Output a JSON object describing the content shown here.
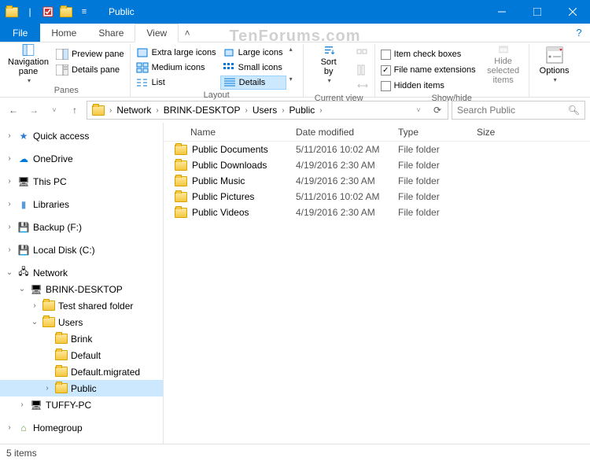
{
  "window": {
    "title": "Public"
  },
  "watermark": "TenForums.com",
  "ribbon_tabs": {
    "file": "File",
    "home": "Home",
    "share": "Share",
    "view": "View"
  },
  "ribbon": {
    "panes": {
      "nav_label": "Navigation\npane",
      "preview": "Preview pane",
      "details": "Details pane",
      "group": "Panes"
    },
    "layout": {
      "xl": "Extra large icons",
      "lg": "Large icons",
      "md": "Medium icons",
      "sm": "Small icons",
      "list": "List",
      "details": "Details",
      "group": "Layout"
    },
    "current_view": {
      "sort_label": "Sort\nby",
      "group": "Current view"
    },
    "showhide": {
      "item_check": "Item check boxes",
      "file_ext": "File name extensions",
      "hidden": "Hidden items",
      "hide_selected": "Hide selected\nitems",
      "group": "Show/hide"
    },
    "options": "Options"
  },
  "breadcrumb": [
    "Network",
    "BRINK-DESKTOP",
    "Users",
    "Public"
  ],
  "search_placeholder": "Search Public",
  "tree": {
    "quick_access": "Quick access",
    "onedrive": "OneDrive",
    "this_pc": "This PC",
    "libraries": "Libraries",
    "backup": "Backup (F:)",
    "local_disk": "Local Disk (C:)",
    "network": "Network",
    "brink": "BRINK-DESKTOP",
    "test_shared": "Test shared folder",
    "users": "Users",
    "brink_user": "Brink",
    "default": "Default",
    "default_mig": "Default.migrated",
    "public": "Public",
    "tuffy": "TUFFY-PC",
    "homegroup": "Homegroup"
  },
  "columns": {
    "name": "Name",
    "date": "Date modified",
    "type": "Type",
    "size": "Size"
  },
  "files": [
    {
      "name": "Public Documents",
      "date": "5/11/2016 10:02 AM",
      "type": "File folder"
    },
    {
      "name": "Public Downloads",
      "date": "4/19/2016 2:30 AM",
      "type": "File folder"
    },
    {
      "name": "Public Music",
      "date": "4/19/2016 2:30 AM",
      "type": "File folder"
    },
    {
      "name": "Public Pictures",
      "date": "5/11/2016 10:02 AM",
      "type": "File folder"
    },
    {
      "name": "Public Videos",
      "date": "4/19/2016 2:30 AM",
      "type": "File folder"
    }
  ],
  "status": "5 items",
  "checked": {
    "file_ext": true,
    "item_check": false,
    "hidden": false
  }
}
